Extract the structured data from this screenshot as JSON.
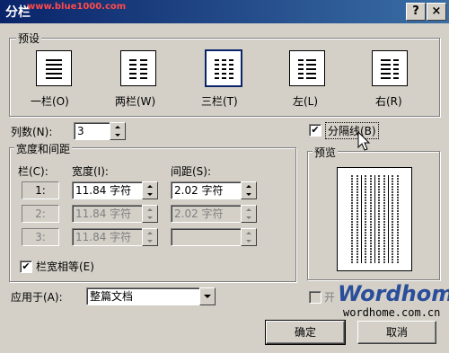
{
  "title": "分栏",
  "watermark": "www.blue1000.com",
  "title_buttons": {
    "help": "?",
    "close": "×"
  },
  "presets": {
    "label": "预设",
    "items": [
      {
        "label": "一栏(O)",
        "icon": "one-column-icon"
      },
      {
        "label": "两栏(W)",
        "icon": "two-columns-icon"
      },
      {
        "label": "三栏(T)",
        "icon": "three-columns-icon",
        "selected": true
      },
      {
        "label": "左(L)",
        "icon": "left-column-icon"
      },
      {
        "label": "右(R)",
        "icon": "right-column-icon"
      }
    ]
  },
  "columns": {
    "label": "列数(N):",
    "value": "3"
  },
  "separator": {
    "label": "分隔线(B)",
    "checked": true
  },
  "width_spacing": {
    "label": "宽度和间距",
    "col_header": "栏(C):",
    "width_header": "宽度(I):",
    "spacing_header": "间距(S):",
    "rows": [
      {
        "col": "1:",
        "width": "11.84 字符",
        "spacing": "2.02 字符",
        "enabled": true
      },
      {
        "col": "2:",
        "width": "11.84 字符",
        "spacing": "2.02 字符",
        "enabled": false
      },
      {
        "col": "3:",
        "width": "11.84 字符",
        "spacing": "",
        "enabled": false
      }
    ]
  },
  "equal_width": {
    "label": "栏宽相等(E)",
    "checked": true
  },
  "preview": {
    "label": "预览",
    "columns": 3
  },
  "apply_to": {
    "label": "应用于(A):",
    "value": "整篇文档"
  },
  "new_column": {
    "label": "开始新栏(U)",
    "visible_text": "开"
  },
  "brand": {
    "logo": "Wordhome",
    "url": "wordhome.com.cn"
  },
  "buttons": {
    "ok": "确定",
    "cancel": "取消"
  },
  "colors": {
    "titlebar": "#0a246a",
    "face": "#d4d0c8"
  }
}
